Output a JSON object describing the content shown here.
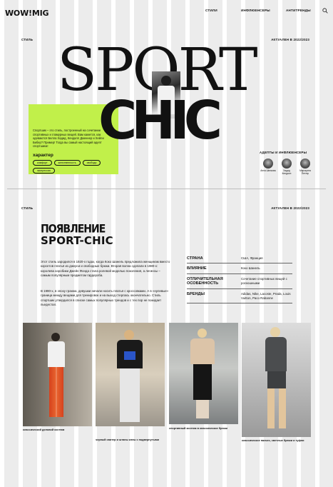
{
  "header": {
    "logo": "WOW!MIG",
    "nav": [
      "СТИЛИ",
      "ИНФЛЮЕНСЕРЫ",
      "АНТИТРЕНДЫ"
    ]
  },
  "hero": {
    "category": "СТИЛЬ",
    "relevance": "АКТУАЛЕН В 2022/2023",
    "title_top": "SPORT",
    "title_bottom": "CHIC",
    "description": "Спортшик – это стиль, построенный на сочетании спортивных и гламурных вещей. Вам кажется, как одеваются Белла Хадид, Кендалл Дженнер и Хейли Бибер? Пример! Тогда вы самый настоящий адепт спортшика!",
    "character_label": "характер",
    "tags": [
      "комфорт",
      "женственность",
      "свобода",
      "экспрессия"
    ],
    "influencers_label": "АДЕПТЫ И ИНФЛЮЕНСЕРЫ",
    "influencers": [
      "Анна Шелкова",
      "Хадид Кендалл",
      "Маргарита Петтер"
    ]
  },
  "section": {
    "category": "СТИЛЬ",
    "relevance": "АКТУАЛЕН В 2022/2023",
    "heading_line1": "ПОЯВЛЕНИЕ",
    "heading_line2": "SPORT-CHIC",
    "paragraph1": "Этот стиль зародился в 1920-х годах, когда Коко Шанель предложила женщинам вместо корсетов платья из джерси и свободные брюки. Вторая волна сделали в 1980-х: королева аэробики Джейн Фонда стала ролевой моделью поколения, а легинсы – самым популярным предметом гардероба.",
    "paragraph2": "В 1990-х, в эпоху гранжа, девушки начали носить платья с кроссовками. А в «нулевые» граница между вещами для тренировок и на выход стерлась окончательно. Стиль спортшик утвердился в списке самых популярных трендов и с тех пор не покидает пьедестал.",
    "facts": [
      {
        "key": "СТРАНА",
        "value": "США, Франция"
      },
      {
        "key": "ВЛИЯНИЕ",
        "value": "Коко Шанель"
      },
      {
        "key": "ОТЛИЧИТЕЛЬНАЯ ОСОБЕННОСТЬ",
        "value": "Сочетание спортивных вещей с роскошными"
      },
      {
        "key": "БРЕНДЫ",
        "value": "Adidas, Nike, Lacoste, Prada, Louis Vuitton, Paco Rabanne"
      }
    ],
    "photos": [
      {
        "caption": "классический деловой костюм"
      },
      {
        "caption": "черный свитер и штаны клеш с подвернутыми"
      },
      {
        "caption": "спортивный костюм в классические брюки"
      },
      {
        "caption": "классическое пальто, светлые брюки и туфли"
      }
    ]
  },
  "colors": {
    "accent": "#c1f04a",
    "stripe": "#ececec",
    "text": "#111111"
  }
}
